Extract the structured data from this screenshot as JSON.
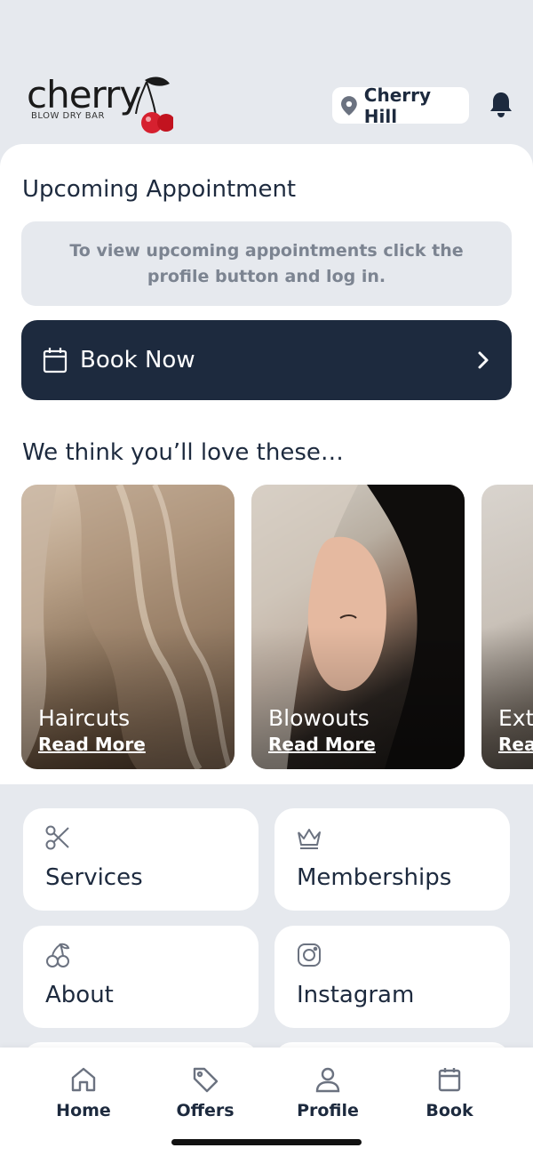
{
  "brand": {
    "logo_word": "cherry",
    "logo_sub": "BLOW DRY BAR"
  },
  "header": {
    "location": "Cherry Hill",
    "icons": {
      "location": "map-pin-icon",
      "notifications": "bell-icon"
    }
  },
  "upcoming": {
    "title": "Upcoming Appointment",
    "notice": "To view upcoming appointments click the profile button and log in."
  },
  "book_now": {
    "label": "Book Now",
    "icon": "calendar-icon"
  },
  "recommendations": {
    "title": "We think you’ll love these…",
    "items": [
      {
        "title": "Haircuts",
        "link": "Read More"
      },
      {
        "title": "Blowouts",
        "link": "Read More"
      },
      {
        "title": "Exte",
        "link": "Rea"
      }
    ]
  },
  "grid": [
    {
      "label": "Services",
      "icon": "scissors-icon"
    },
    {
      "label": "Memberships",
      "icon": "crown-icon"
    },
    {
      "label": "About",
      "icon": "cherry-icon"
    },
    {
      "label": "Instagram",
      "icon": "instagram-icon"
    }
  ],
  "bottom_nav": [
    {
      "label": "Home",
      "icon": "home-icon"
    },
    {
      "label": "Offers",
      "icon": "tag-icon"
    },
    {
      "label": "Profile",
      "icon": "user-icon"
    },
    {
      "label": "Book",
      "icon": "calendar-icon"
    }
  ],
  "colors": {
    "navy": "#1d2a3e",
    "background": "#e6e9ee",
    "cherry_red": "#d6202f"
  }
}
